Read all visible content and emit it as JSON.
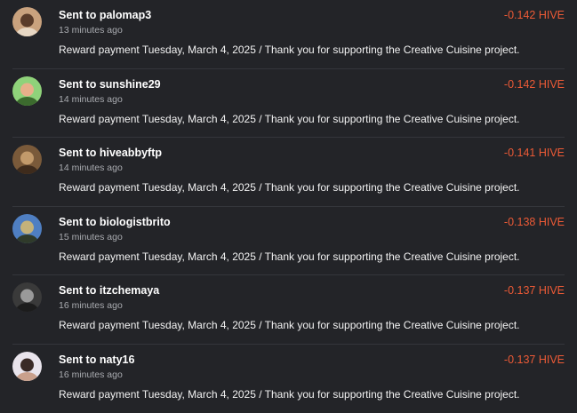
{
  "transactions": [
    {
      "prefix": "Sent to",
      "user": "palomap3",
      "time": "13 minutes ago",
      "amount": "-0.142 HIVE",
      "memo": "Reward payment Tuesday, March 4, 2025 / Thank you for supporting the Creative Cuisine project.",
      "avatar_colors": [
        "#c9a27e",
        "#5a3c2a",
        "#e7d7c4"
      ]
    },
    {
      "prefix": "Sent to",
      "user": "sunshine29",
      "time": "14 minutes ago",
      "amount": "-0.142 HIVE",
      "memo": "Reward payment Tuesday, March 4, 2025 / Thank you for supporting the Creative Cuisine project.",
      "avatar_colors": [
        "#8fd27a",
        "#e7b08a",
        "#3c6b2e"
      ]
    },
    {
      "prefix": "Sent to",
      "user": "hiveabbyftp",
      "time": "14 minutes ago",
      "amount": "-0.141 HIVE",
      "memo": "Reward payment Tuesday, March 4, 2025 / Thank you for supporting the Creative Cuisine project.",
      "avatar_colors": [
        "#7a5a3a",
        "#c29a6b",
        "#3e2b1c"
      ]
    },
    {
      "prefix": "Sent to",
      "user": "biologistbrito",
      "time": "15 minutes ago",
      "amount": "-0.138 HIVE",
      "memo": "Reward payment Tuesday, March 4, 2025 / Thank you for supporting the Creative Cuisine project.",
      "avatar_colors": [
        "#4f7fc2",
        "#c4b27a",
        "#2f3a2a"
      ]
    },
    {
      "prefix": "Sent to",
      "user": "itzchemaya",
      "time": "16 minutes ago",
      "amount": "-0.137 HIVE",
      "memo": "Reward payment Tuesday, March 4, 2025 / Thank you for supporting the Creative Cuisine project.",
      "avatar_colors": [
        "#3a3a3a",
        "#9a9a9a",
        "#1c1c1c"
      ]
    },
    {
      "prefix": "Sent to",
      "user": "naty16",
      "time": "16 minutes ago",
      "amount": "-0.137 HIVE",
      "memo": "Reward payment Tuesday, March 4, 2025 / Thank you for supporting the Creative Cuisine project.",
      "avatar_colors": [
        "#e9e4ec",
        "#3a2a26",
        "#c9a08c"
      ]
    }
  ],
  "colors": {
    "background": "#232428",
    "amount_negative": "#ec5a36",
    "muted_text": "#a9abb0",
    "divider": "#34363b"
  }
}
